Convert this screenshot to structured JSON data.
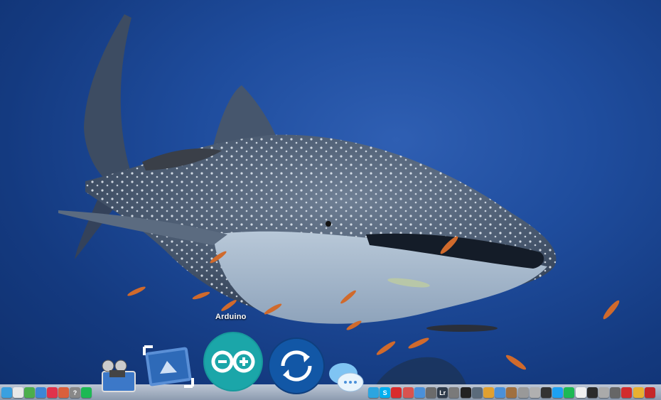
{
  "tooltip": {
    "label": "Arduino"
  },
  "dock": {
    "large_icons": [
      {
        "name": "movie-maker-icon"
      },
      {
        "name": "photo-slideshow-icon"
      },
      {
        "name": "arduino-icon"
      },
      {
        "name": "sync-icon"
      },
      {
        "name": "messages-icon"
      }
    ],
    "left_small_icons": [
      {
        "name": "app-icon-1",
        "color": "#3aa0e0"
      },
      {
        "name": "calendar-icon",
        "color": "#e8e8e8"
      },
      {
        "name": "app-icon-3",
        "color": "#4cae4c"
      },
      {
        "name": "globe-icon",
        "color": "#3d86d6"
      },
      {
        "name": "pocket-icon",
        "color": "#e0334b"
      },
      {
        "name": "app-icon-6",
        "color": "#d95f3b"
      },
      {
        "name": "help-icon",
        "color": "#888888",
        "text": "?"
      },
      {
        "name": "spotify-icon",
        "color": "#1db954"
      }
    ],
    "right_small_icons": [
      {
        "name": "telegram-icon",
        "color": "#2ca5e0"
      },
      {
        "name": "skype-icon",
        "color": "#00aff0",
        "text": "S"
      },
      {
        "name": "record-icon",
        "color": "#d92c2c"
      },
      {
        "name": "app-icon-r4",
        "color": "#d9534f"
      },
      {
        "name": "app-icon-r5",
        "color": "#4a90d9"
      },
      {
        "name": "app-icon-r6",
        "color": "#6b6b6b"
      },
      {
        "name": "lightroom-icon",
        "color": "#2f3b4a",
        "text": "Lr"
      },
      {
        "name": "app-icon-r8",
        "color": "#7a7a7a"
      },
      {
        "name": "terminal-icon",
        "color": "#222222"
      },
      {
        "name": "app-icon-r10",
        "color": "#5b6b7b"
      },
      {
        "name": "app-icon-r11",
        "color": "#e0a030"
      },
      {
        "name": "app-icon-r12",
        "color": "#4a90d9"
      },
      {
        "name": "app-icon-r13",
        "color": "#a07040"
      },
      {
        "name": "app-icon-r14",
        "color": "#999999"
      },
      {
        "name": "app-icon-r15",
        "color": "#b0b0b0"
      },
      {
        "name": "wifi-icon",
        "color": "#333333"
      },
      {
        "name": "twitter-icon",
        "color": "#1da1f2"
      },
      {
        "name": "spotify-icon-2",
        "color": "#1db954"
      },
      {
        "name": "notes-icon",
        "color": "#f0f0f0"
      },
      {
        "name": "activity-monitor-icon",
        "color": "#2b2b2b"
      },
      {
        "name": "app-icon-r21",
        "color": "#aaaaaa"
      },
      {
        "name": "app-icon-r22",
        "color": "#666666"
      },
      {
        "name": "acrobat-icon",
        "color": "#d22c2c"
      },
      {
        "name": "chrome-icon",
        "color": "#e8b030"
      },
      {
        "name": "acrobat-icon-2",
        "color": "#c62828"
      }
    ]
  }
}
